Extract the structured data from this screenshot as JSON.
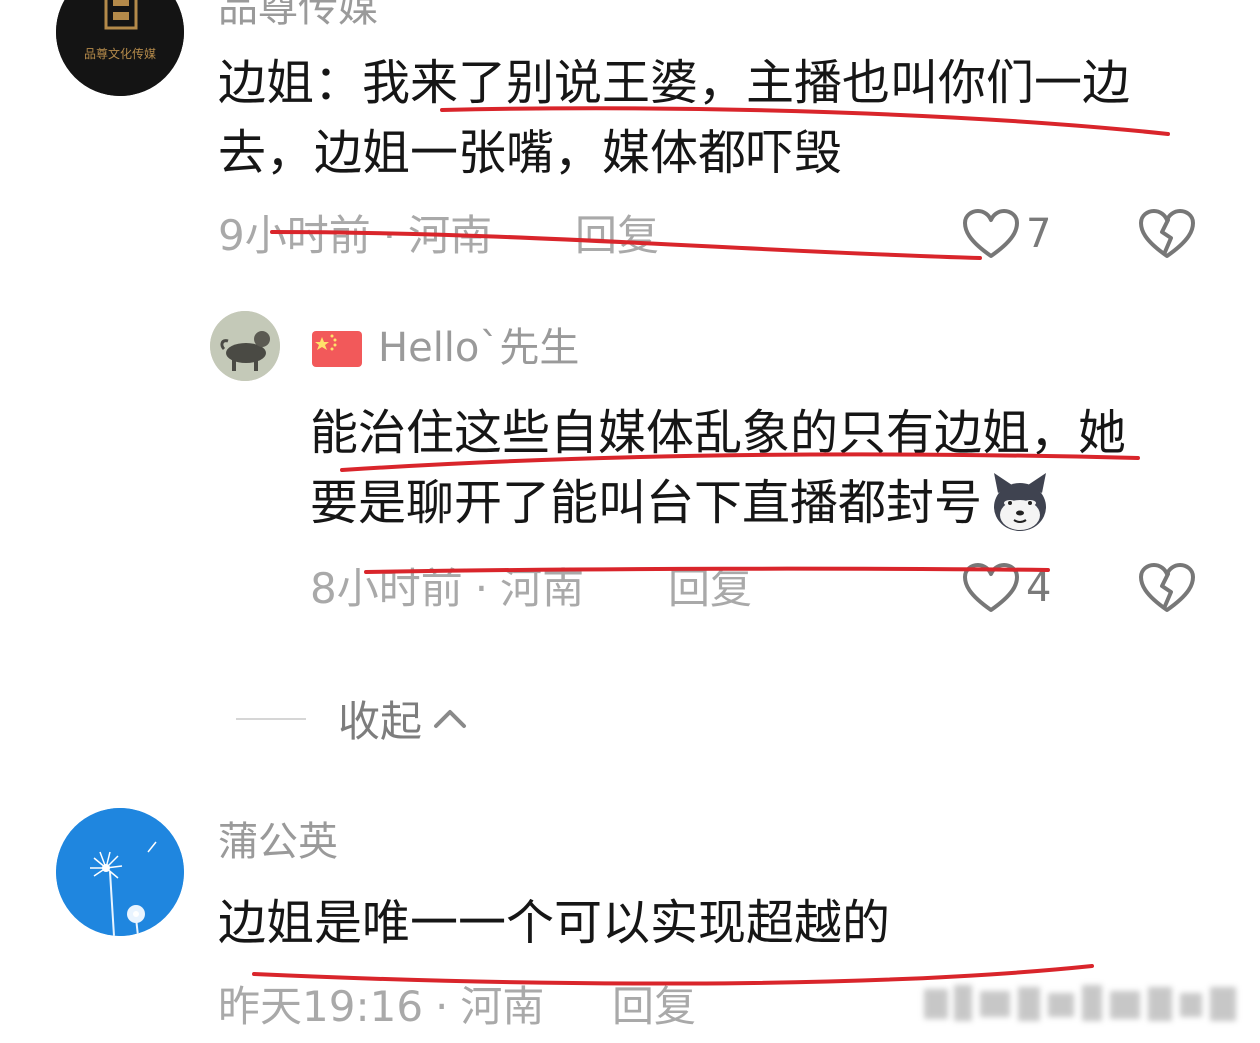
{
  "comments": [
    {
      "username": "品尊传媒",
      "avatar_text": "品尊文化传媒",
      "text": "边姐：我来了别说王婆，主播也叫你们一边去，边姐一张嘴，媒体都吓毁",
      "time": "9小时前",
      "location": "河南",
      "reply_label": "回复",
      "likes": "7"
    },
    {
      "username": "Hello`先生",
      "flag": "china-flag",
      "text_line1": "能治住这些自媒体乱象的只有边姐，她",
      "text_line2": "要是聊开了能叫台下直播都封号",
      "emoji": "dog-emoji",
      "time": "8小时前",
      "location": "河南",
      "reply_label": "回复",
      "likes": "4"
    },
    {
      "username": "蒲公英",
      "text": "边姐是唯一一个可以实现超越的",
      "time": "昨天19:16",
      "location": "河南",
      "reply_label": "回复"
    }
  ],
  "collapse_label": "收起",
  "icons": {
    "like": "heart-outline-icon",
    "dislike": "broken-heart-icon",
    "collapse": "chevron-up-icon"
  },
  "colors": {
    "annotation": "#d9252b",
    "muted_text": "#a9a9a9"
  }
}
